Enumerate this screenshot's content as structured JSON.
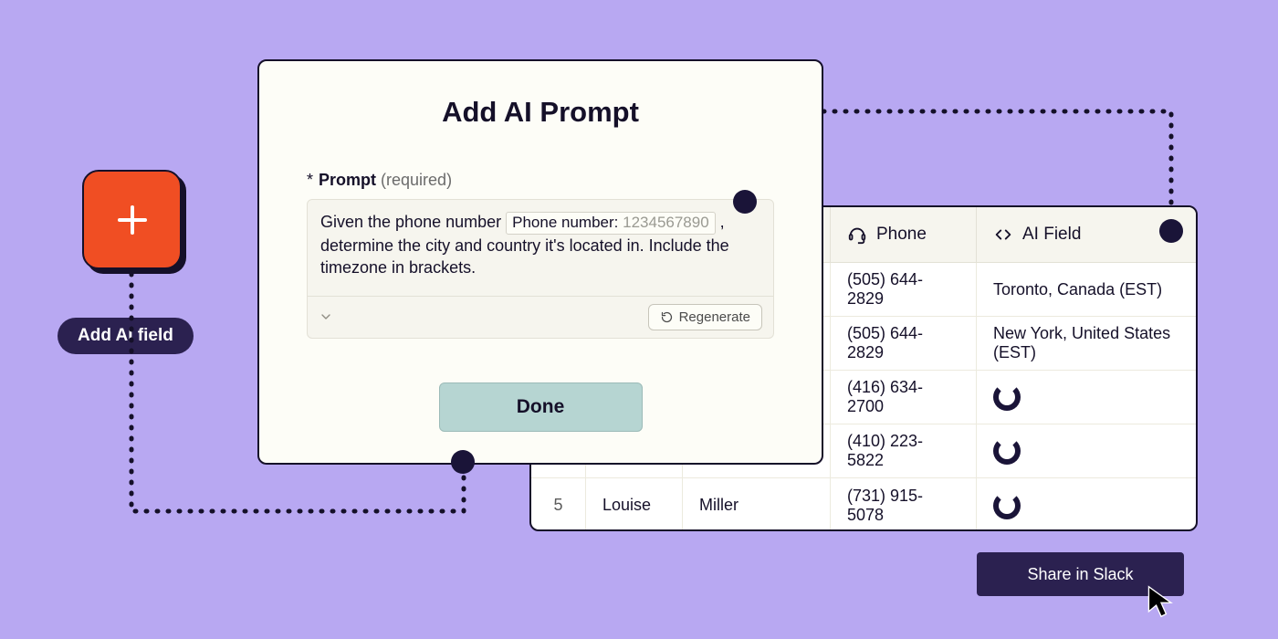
{
  "add": {
    "pill_label": "Add AI field"
  },
  "modal": {
    "title": "Add AI Prompt",
    "field_label": "Prompt",
    "required_text": "(required)",
    "prompt_pre": "Given the phone number ",
    "chip_label": "Phone number:",
    "chip_example": "1234567890",
    "prompt_post": " , determine the city and country it's located in. Include the timezone in brackets.",
    "regenerate_label": "Regenerate",
    "done_label": "Done"
  },
  "table": {
    "headers": {
      "phone": "Phone",
      "ai": "AI Field"
    },
    "rows": [
      {
        "idx": "",
        "first": "",
        "last": "",
        "phone": "(505) 644-2829",
        "ai": "Toronto, Canada (EST)"
      },
      {
        "idx": "",
        "first": "",
        "last": "",
        "phone": "(505) 644-2829",
        "ai": "New York, United States (EST)"
      },
      {
        "idx": "",
        "first": "",
        "last": "",
        "phone": "(416) 634-2700",
        "ai": ""
      },
      {
        "idx": "",
        "first": "",
        "last": "",
        "phone": "(410) 223-5822",
        "ai": ""
      },
      {
        "idx": "5",
        "first": "Louise",
        "last": "Miller",
        "phone": "(731) 915-5078",
        "ai": ""
      }
    ]
  },
  "share": {
    "label": "Share in Slack"
  }
}
